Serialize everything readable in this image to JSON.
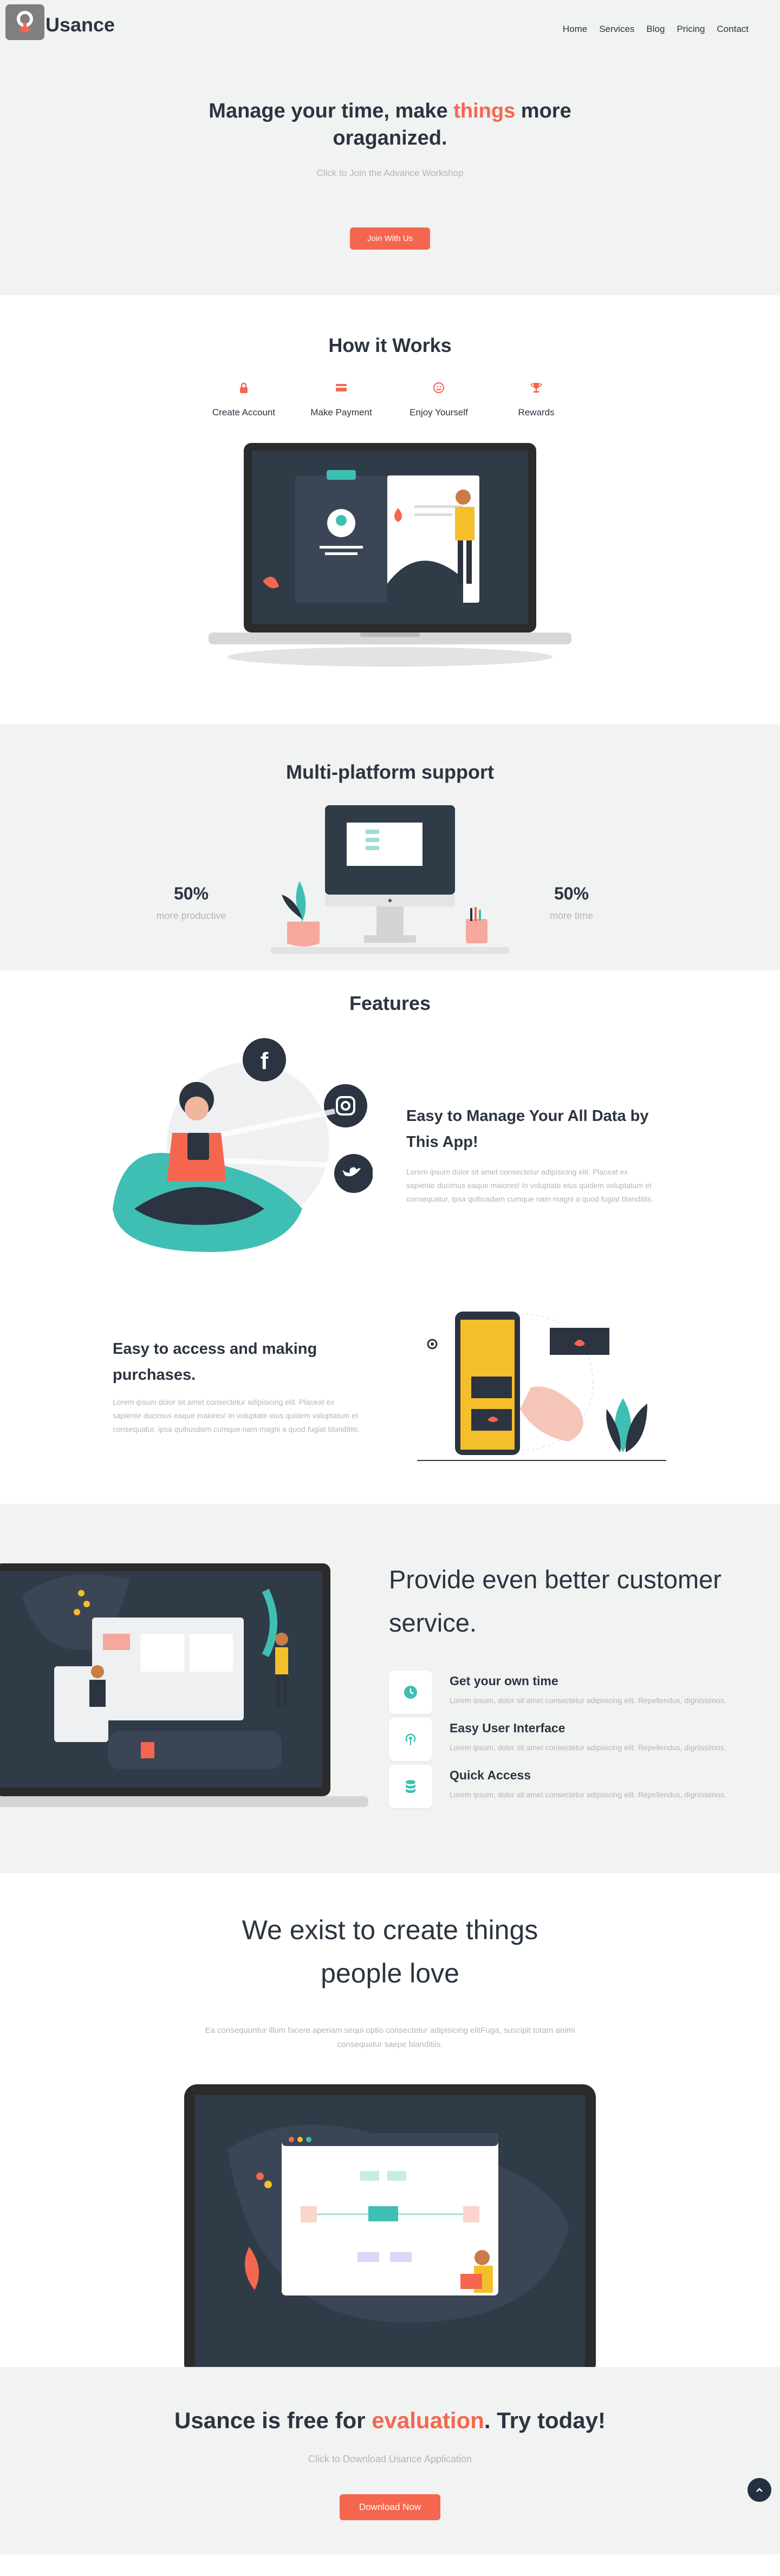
{
  "brand": {
    "name": "Usance"
  },
  "nav": {
    "items": [
      "Home",
      "Services",
      "Blog",
      "Pricing",
      "Contact"
    ]
  },
  "hero": {
    "title_before": "Manage your time, make ",
    "title_highlight": "things",
    "title_after": " more oraganized.",
    "subtitle": "Click to Join the Advance Workshop",
    "button": "Join With Us"
  },
  "how": {
    "title": "How it Works",
    "steps": [
      {
        "label": "Create Account",
        "icon": "lock-icon"
      },
      {
        "label": "Make Payment",
        "icon": "credit-card-icon"
      },
      {
        "label": "Enjoy Yourself",
        "icon": "smile-icon"
      },
      {
        "label": "Rewards",
        "icon": "trophy-icon"
      }
    ]
  },
  "multi": {
    "title": "Multi-platform support",
    "left_stat": {
      "value": "50%",
      "label": "more productive"
    },
    "right_stat": {
      "value": "50%",
      "label": "more time"
    }
  },
  "features": {
    "title": "Features",
    "items": [
      {
        "heading": "Easy to Manage Your All Data by This App!",
        "text": "Lorem ipsum dolor sit amet consectetur adipisicing elit. Placeat ex sapiente ducimus eaque maiores! In voluptate eius quidem voluptatum et consequatur, ipsa quibusdam cumque nam magni a quod fugiat blanditiis."
      },
      {
        "heading": "Easy to access and making purchases.",
        "text": "Lorem ipsum dolor sit amet consectetur adipisicing elit. Placeat ex sapiente ducimus eaque maiores! In voluptate eius quidem voluptatum et consequatur, ipsa quibusdam cumque nam magni a quod fugiat blanditiis."
      }
    ]
  },
  "service": {
    "title": "Provide even better customer service.",
    "items": [
      {
        "title": "Get your own time",
        "text": "Lorem ipsum, dolor sit amet consectetur adipisicing elit. Repellendus, dignissimos.",
        "icon": "clock-icon"
      },
      {
        "title": "Easy User Interface",
        "text": "Lorem ipsum, dolor sit amet consectetur adipisicing elit. Repellendus, dignissimos.",
        "icon": "broadcast-icon"
      },
      {
        "title": "Quick Access",
        "text": "Lorem ipsum, dolor sit amet consectetur adipisicing elit. Repellendus, dignissimos.",
        "icon": "database-icon"
      }
    ]
  },
  "exist": {
    "title": "We exist to create things people love",
    "text": "Ea consequuntur illum facere aperiam sequi optio consectetur adipisicing elitFuga, suscipit totam animi consequatur saepe blanditiis."
  },
  "cta": {
    "title_before": "Usance is free for ",
    "title_highlight": "evaluation",
    "title_after": ". Try today!",
    "subtitle": "Click to Download Usance Application",
    "button": "Download Now"
  },
  "colors": {
    "accent": "#f5664f",
    "dark": "#2b3440",
    "teal": "#3fbfb3",
    "yellow": "#f5bf2b",
    "muted": "#b5b5b5",
    "section_bg": "#f1f2f2"
  }
}
